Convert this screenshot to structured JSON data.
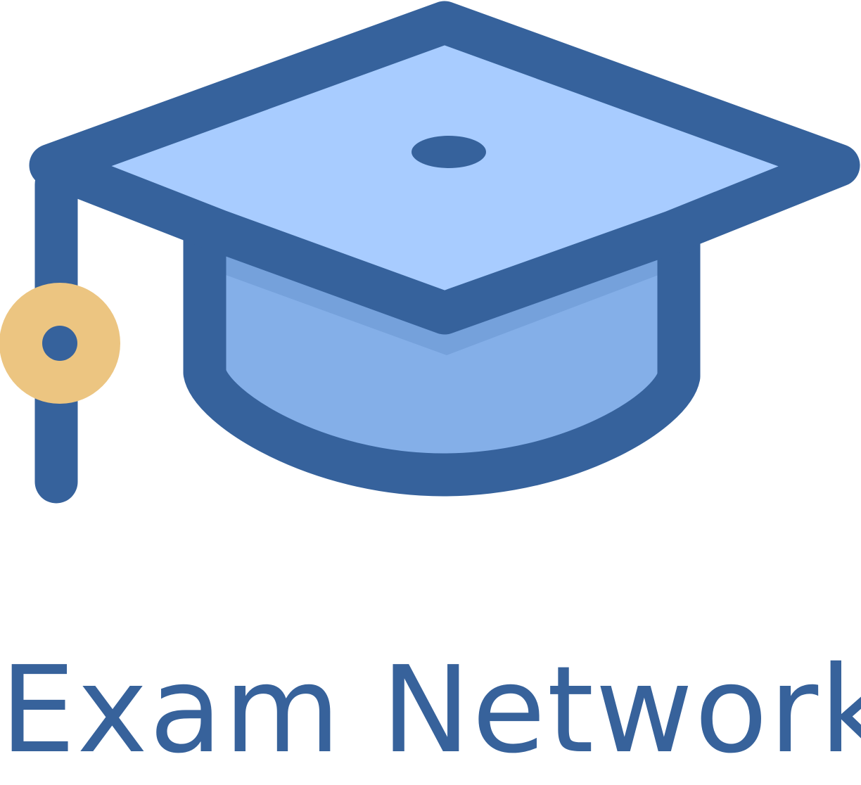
{
  "brand": {
    "name": "Exam Network",
    "icon": "graduation-cap-icon"
  },
  "colors": {
    "outline": "#36629C",
    "top": "#A8CCFF",
    "band": "#75A1DB",
    "body": "#84AFE8",
    "tassel": "#ECC581",
    "text": "#37629B",
    "background": "#FFFFFF"
  }
}
